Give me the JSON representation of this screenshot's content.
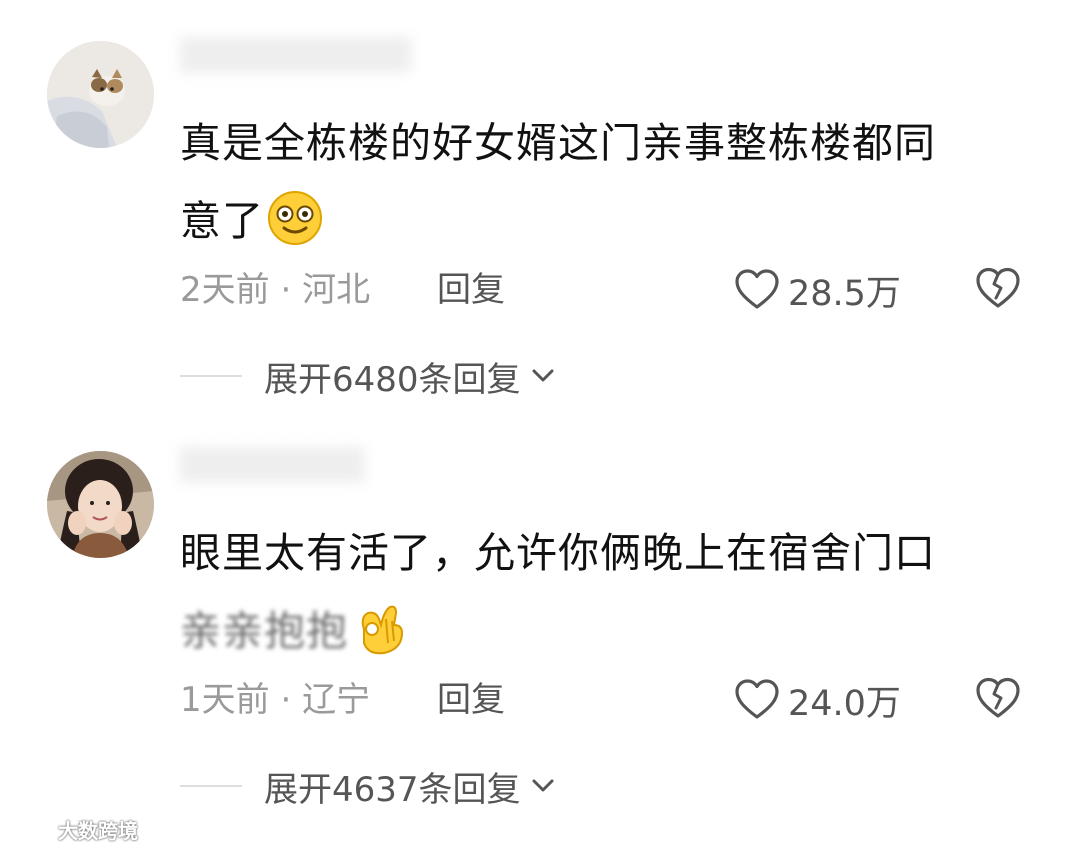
{
  "comments": [
    {
      "text_line1": "真是全栋楼的好女婿这门亲事整栋楼都同",
      "text_line2": "意了",
      "time": "2天前",
      "separator": "·",
      "location": "河北",
      "reply_label": "回复",
      "likes": "28.5万",
      "expand_label": "展开6480条回复",
      "emoji_icon": "smiling-face-icon"
    },
    {
      "text_line1": "眼里太有活了，允许你俩晚上在宿舍门口",
      "text_line2": "亲亲抱抱",
      "time": "1天前",
      "separator": "·",
      "location": "辽宁",
      "reply_label": "回复",
      "likes": "24.0万",
      "expand_label": "展开4637条回复",
      "emoji_icon": "ok-hand-icon"
    }
  ],
  "watermark": "大数跨境",
  "colors": {
    "text": "#111111",
    "meta": "#9a9a9a",
    "action": "#555555"
  }
}
